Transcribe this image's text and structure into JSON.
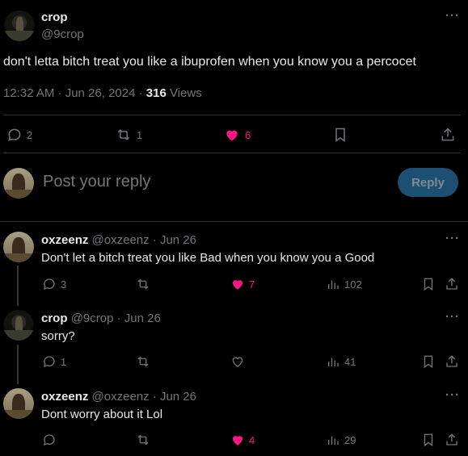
{
  "main_tweet": {
    "display_name": "crop",
    "handle": "@9crop",
    "text": "don't letta bitch treat you like a ibuprofen when you know you a percocet",
    "time": "12:32 AM · Jun 26, 2024 · ",
    "views_count": "316",
    "views_label": " Views",
    "more_label": "···",
    "actions": {
      "replies": "2",
      "reposts": "1",
      "likes": "6"
    }
  },
  "composer": {
    "placeholder": "Post your reply",
    "button_label": "Reply"
  },
  "replies": [
    {
      "display_name": "oxzeenz",
      "handle": "@oxzeenz · Jun 26",
      "text": "Don't let a bitch treat you like Bad when you know you a Good",
      "replies": "3",
      "likes": "7",
      "views": "102",
      "liked": true
    },
    {
      "display_name": "crop",
      "handle": "@9crop · Jun 26",
      "text": "sorry?",
      "replies": "1",
      "likes": "",
      "views": "41",
      "liked": false
    },
    {
      "display_name": "oxzeenz",
      "handle": "@oxzeenz · Jun 26",
      "text": "Dont worry about it Lol",
      "replies": "",
      "likes": "4",
      "views": "29",
      "liked": true
    }
  ],
  "colors": {
    "background": "#000000",
    "text": "#e7e9ea",
    "muted": "#71767b",
    "like": "#f91880",
    "reply_button": "#1d4f72"
  }
}
